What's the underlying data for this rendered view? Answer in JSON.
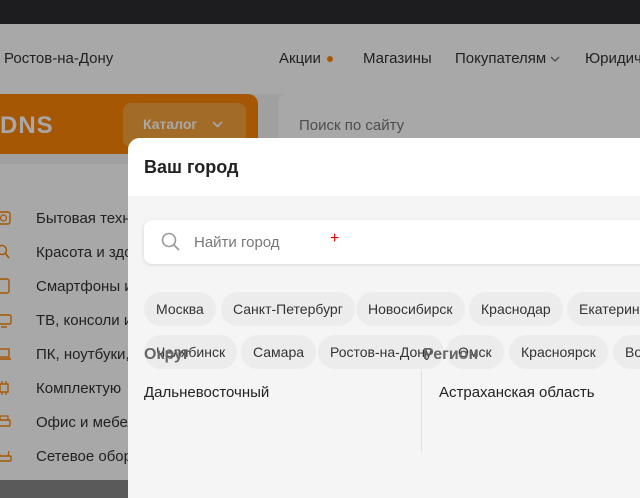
{
  "header": {
    "city": "Ростов-на-Дону",
    "nav": [
      {
        "label": "Акции"
      },
      {
        "label": "Магазины"
      },
      {
        "label": "Покупателям"
      },
      {
        "label": "Юридич"
      }
    ],
    "logo": "DNS",
    "catalog_label": "Каталог",
    "search_placeholder": "Поиск по сайту"
  },
  "sidebar": {
    "items": [
      {
        "label": "Бытовая техн",
        "icon": "appliance-icon"
      },
      {
        "label": "Красота и здо",
        "icon": "hairdryer-icon"
      },
      {
        "label": "Смартфоны и",
        "icon": "smartphone-icon"
      },
      {
        "label": "ТВ, консоли и",
        "icon": "tv-icon"
      },
      {
        "label": "ПК, ноутбуки,",
        "icon": "laptop-icon"
      },
      {
        "label": "Комплектую",
        "icon": "chip-icon"
      },
      {
        "label": "Офис и мебел",
        "icon": "printer-icon"
      },
      {
        "label": "Сетевое обор",
        "icon": "router-icon"
      }
    ]
  },
  "modal": {
    "title": "Ваш город",
    "search_placeholder": "Найти город",
    "popular_cities_row1": [
      "Москва",
      "Санкт-Петербург",
      "Новосибирск",
      "Краснодар",
      "Екатеринб"
    ],
    "popular_cities_row2": [
      "Челябинск",
      "Самара",
      "Ростов-на-Дону",
      "Омск",
      "Красноярск",
      "Во"
    ],
    "district_heading": "Округ",
    "region_heading": "Регион",
    "district_first": "Дальневосточный",
    "region_first": "Астраханская область"
  },
  "colors": {
    "brand_orange": "#fc8507",
    "overlay": "rgba(0,0,0,0.34)"
  }
}
